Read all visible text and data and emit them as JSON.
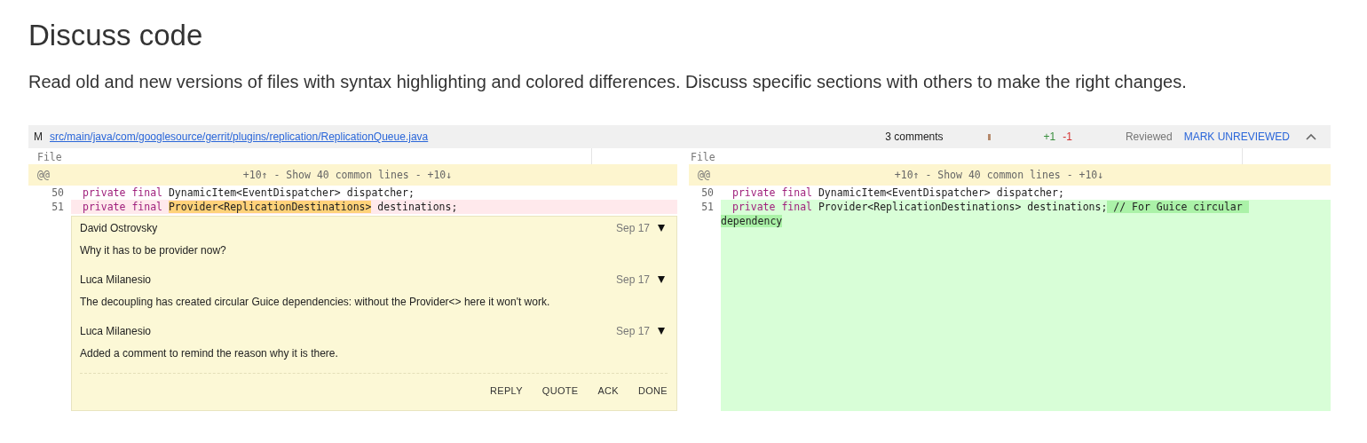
{
  "heading": "Discuss code",
  "description": "Read old and new versions of files with syntax highlighting and colored differences. Discuss specific sections with others to make the right changes.",
  "file": {
    "status": "M",
    "path": "src/main/java/com/googlesource/gerrit/plugins/replication/ReplicationQueue.java",
    "comment_count": "3 comments",
    "added": "+1",
    "removed": "-1",
    "reviewed_label": "Reviewed",
    "mark_button": "MARK UNREVIEWED",
    "expanded": true
  },
  "sides": [
    {
      "file_label": "File",
      "skip_marker": "@@",
      "skip_text": "+10↑ - Show 40 common lines - +10↓",
      "lines": [
        {
          "number": "50",
          "kind": "context",
          "tokens": [
            {
              "kind": "keyword",
              "text": "private final"
            },
            {
              "kind": "plain",
              "text": "DynamicItem<EventDispatcher> dispatcher;"
            }
          ]
        },
        {
          "number": "51",
          "kind": "removed",
          "tokens": [
            {
              "kind": "keyword",
              "text": "private final"
            },
            {
              "kind": "changed",
              "text": "Provider<ReplicationDestinations>"
            },
            {
              "kind": "plain",
              "text": " destinations;"
            }
          ]
        }
      ],
      "thread": {
        "comments": [
          {
            "author": "David Ostrovsky",
            "date": "Sep 17",
            "text": "Why it has to be provider now?"
          },
          {
            "author": "Luca Milanesio",
            "date": "Sep 17",
            "text": "The decoupling has created circular Guice dependencies: without the Provider<> here it won't work."
          },
          {
            "author": "Luca Milanesio",
            "date": "Sep 17",
            "text": "Added a comment to remind the reason why it is there."
          }
        ],
        "actions": [
          "REPLY",
          "QUOTE",
          "ACK",
          "DONE"
        ]
      }
    },
    {
      "file_label": "File",
      "skip_marker": "@@",
      "skip_text": "+10↑ - Show 40 common lines - +10↓",
      "lines": [
        {
          "number": "50",
          "kind": "context",
          "tokens": [
            {
              "kind": "keyword",
              "text": "private final"
            },
            {
              "kind": "plain",
              "text": "DynamicItem<EventDispatcher> dispatcher;"
            }
          ]
        },
        {
          "number": "51",
          "kind": "added",
          "tokens": [
            {
              "kind": "keyword",
              "text": "private final"
            },
            {
              "kind": "plain",
              "text": "Provider<ReplicationDestinations> destinations;"
            },
            {
              "kind": "changed",
              "text": " // For Guice circular "
            },
            {
              "kind": "changed",
              "text": "dependency"
            }
          ]
        }
      ]
    }
  ]
}
